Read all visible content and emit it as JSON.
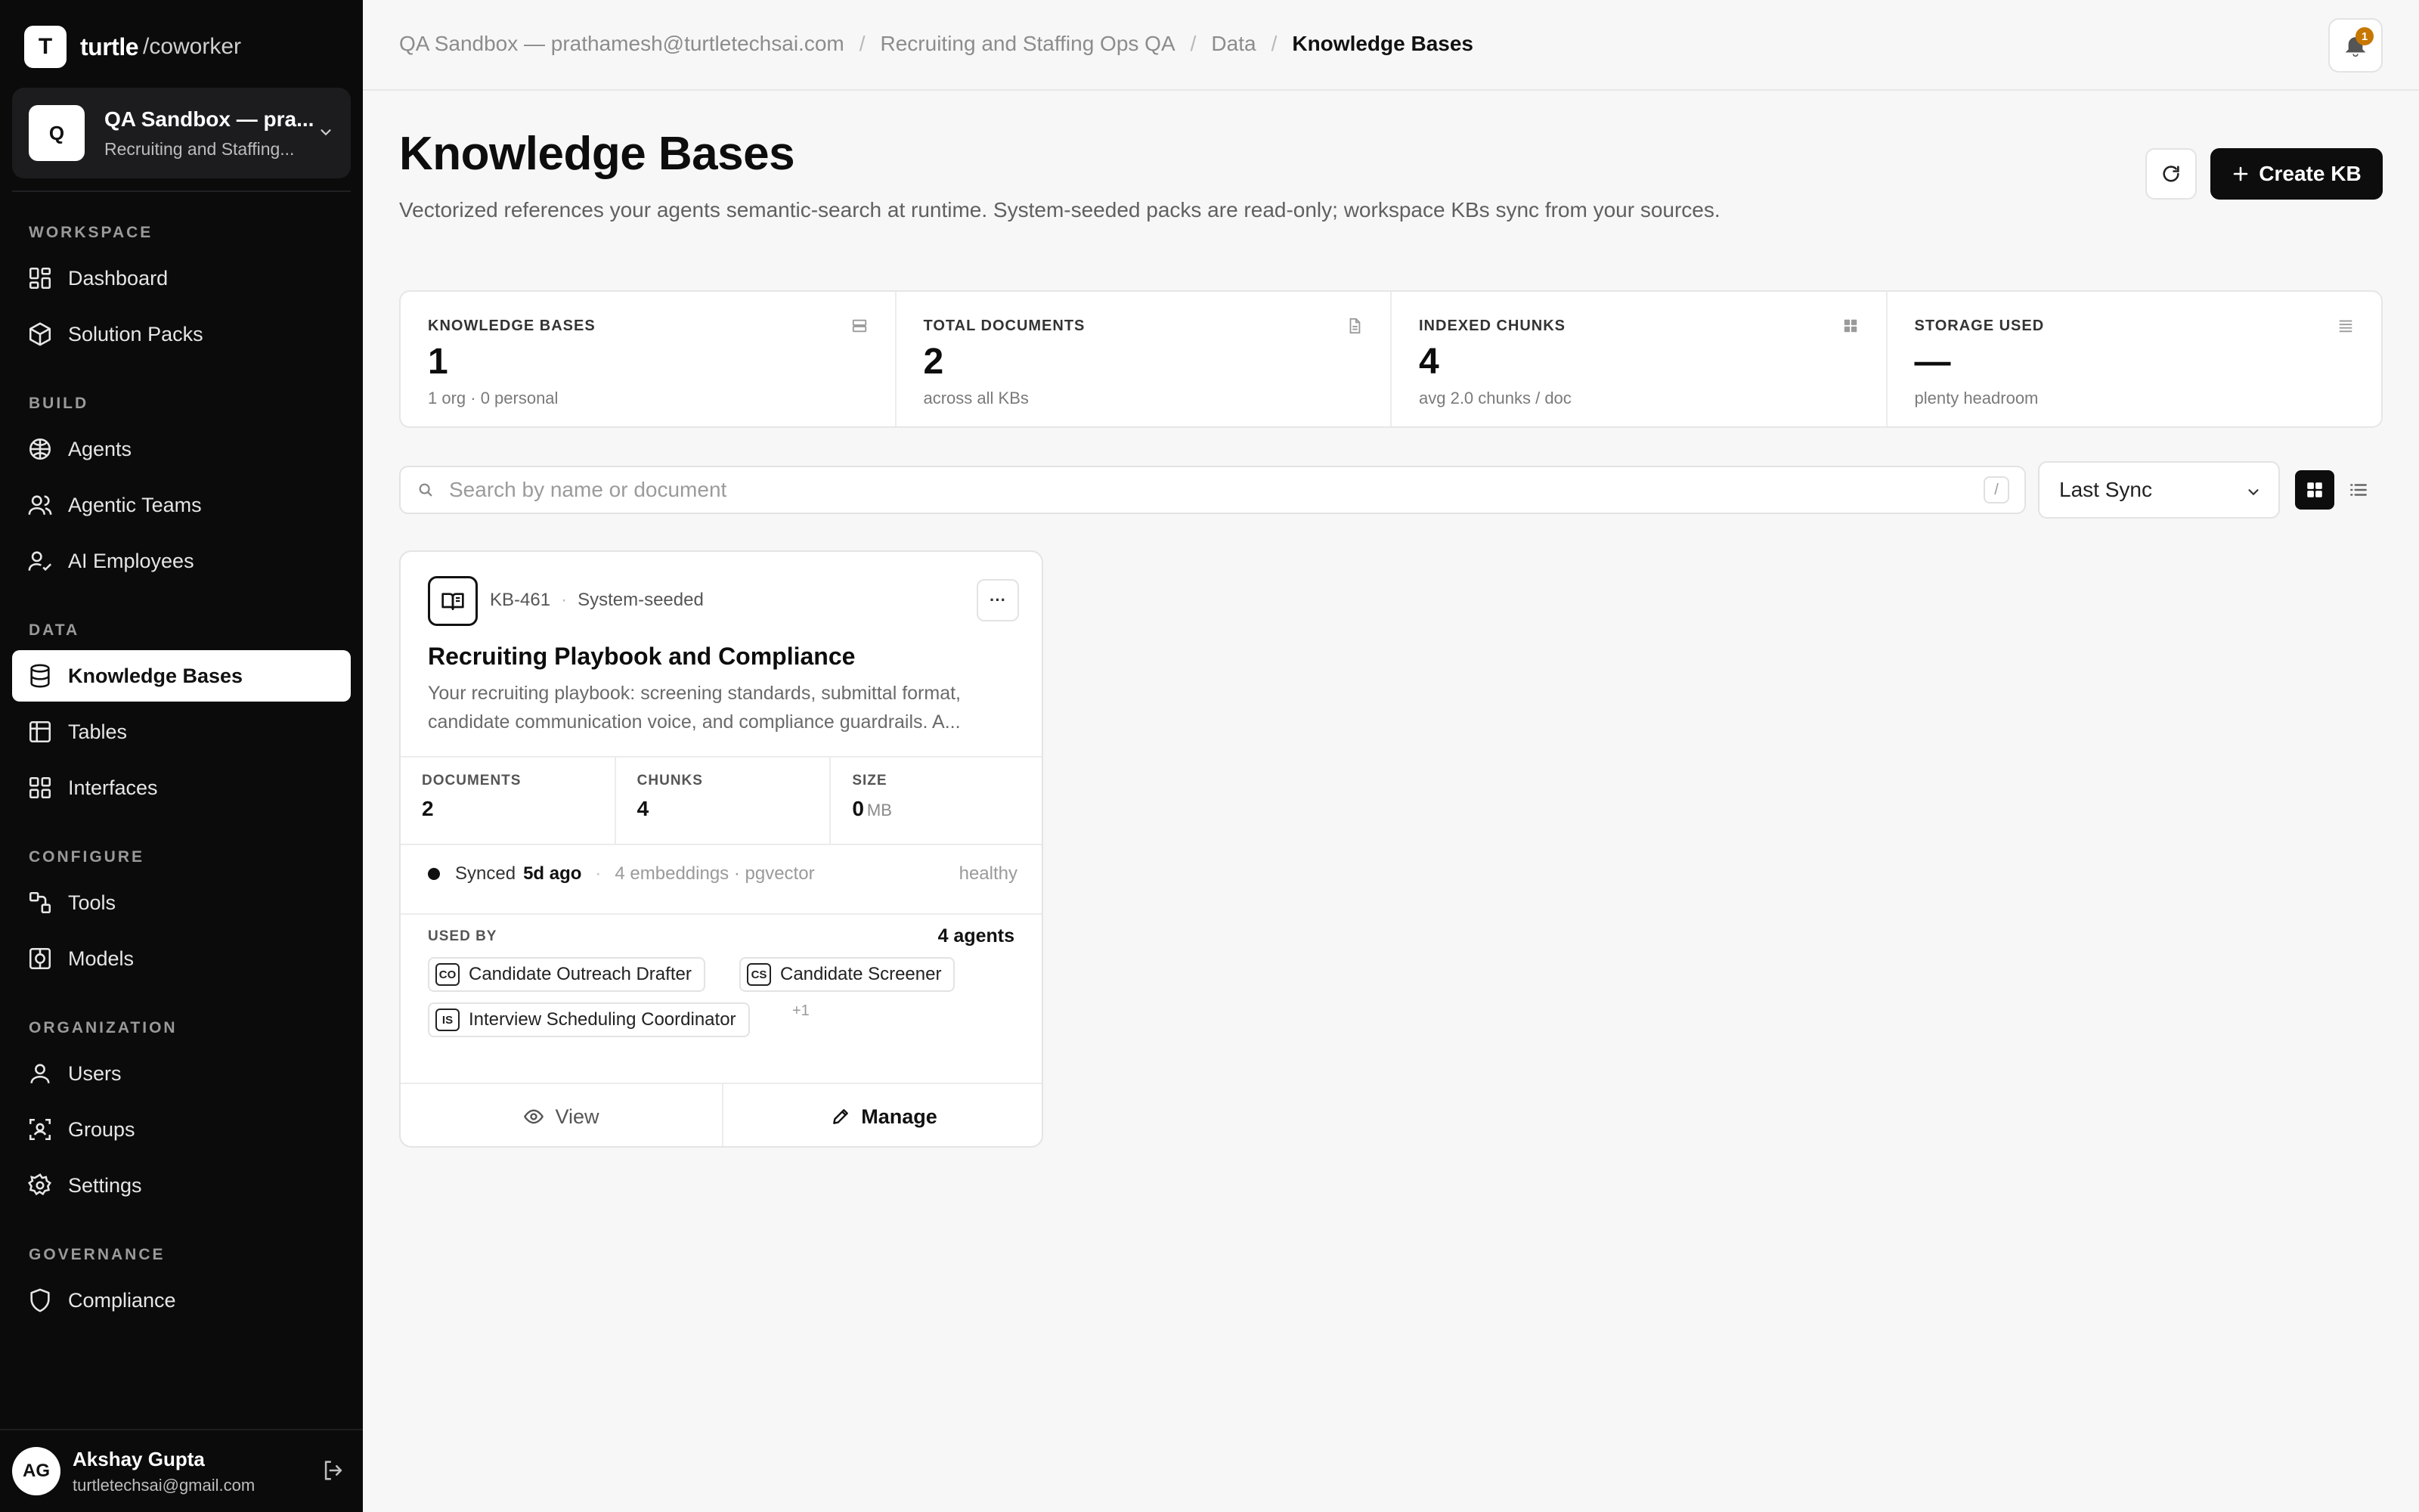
{
  "brand": {
    "mark": "T",
    "name": "turtle",
    "suffix": "/coworker"
  },
  "workspace": {
    "avatar": "Q",
    "name": "QA Sandbox — pra...",
    "org": "Recruiting and Staffing..."
  },
  "nav": {
    "sections": {
      "workspace": "WORKSPACE",
      "build": "BUILD",
      "data": "DATA",
      "configure": "CONFIGURE",
      "organization": "ORGANIZATION",
      "governance": "GOVERNANCE"
    },
    "items": {
      "dashboard": "Dashboard",
      "solution_packs": "Solution Packs",
      "agents": "Agents",
      "agentic_teams": "Agentic Teams",
      "ai_employees": "AI Employees",
      "knowledge_bases": "Knowledge Bases",
      "tables": "Tables",
      "interfaces": "Interfaces",
      "tools": "Tools",
      "models": "Models",
      "users": "Users",
      "groups": "Groups",
      "settings": "Settings",
      "compliance": "Compliance"
    },
    "active": "knowledge_bases"
  },
  "user": {
    "initials": "AG",
    "name": "Akshay Gupta",
    "email": "turtletechsai@gmail.com"
  },
  "breadcrumb": [
    "QA Sandbox — prathamesh@turtletechsai.com",
    "Recruiting and Staffing Ops QA",
    "Data",
    "Knowledge Bases"
  ],
  "notifications": {
    "count": "1"
  },
  "page": {
    "title": "Knowledge Bases",
    "subtitle": "Vectorized references your agents semantic-search at runtime. System-seeded packs are read-only; workspace KBs sync from your sources.",
    "create_label": "Create KB"
  },
  "stats": [
    {
      "label": "KNOWLEDGE BASES",
      "value": "1",
      "hint": "1 org · 0 personal",
      "icon": "database-icon"
    },
    {
      "label": "TOTAL DOCUMENTS",
      "value": "2",
      "hint": "across all KBs",
      "icon": "document-icon"
    },
    {
      "label": "INDEXED CHUNKS",
      "value": "4",
      "hint": "avg 2.0 chunks / doc",
      "icon": "grid-icon"
    },
    {
      "label": "STORAGE USED",
      "value": "—",
      "hint": "plenty headroom",
      "icon": "storage-icon"
    }
  ],
  "search": {
    "placeholder": "Search by name or document",
    "shortcut": "/"
  },
  "sort": {
    "selected": "Last Sync"
  },
  "view_mode": "grid",
  "kb_card": {
    "id": "KB-461",
    "source": "System-seeded",
    "title": "Recruiting Playbook and Compliance",
    "description": "Your recruiting playbook: screening standards, submittal format, candidate communication voice, and compliance guardrails. A...",
    "metrics": {
      "documents_label": "DOCUMENTS",
      "documents": "2",
      "chunks_label": "CHUNKS",
      "chunks": "4",
      "size_label": "SIZE",
      "size": "0",
      "size_unit": "MB"
    },
    "sync": {
      "status": "Synced",
      "ago": "5d ago",
      "detail": "4 embeddings · pgvector",
      "health": "healthy"
    },
    "used_by_label": "USED BY",
    "used_by_count": "4 agents",
    "agents": [
      {
        "abbr": "CO",
        "name": "Candidate Outreach Drafter"
      },
      {
        "abbr": "CS",
        "name": "Candidate Screener"
      },
      {
        "abbr": "IS",
        "name": "Interview Scheduling Coordinator"
      }
    ],
    "more_agents": "+1",
    "view_label": "View",
    "manage_label": "Manage"
  }
}
